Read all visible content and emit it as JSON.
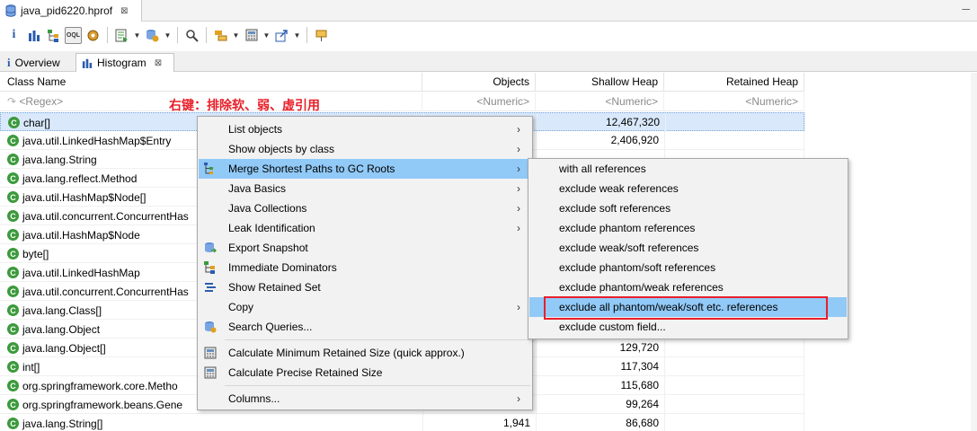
{
  "editor_tab": {
    "title": "java_pid6220.hprof",
    "close": "⊠"
  },
  "inner_tabs": {
    "overview": "Overview",
    "histogram": "Histogram",
    "close": "⊠"
  },
  "columns": {
    "class_name": "Class Name",
    "objects": "Objects",
    "shallow_heap": "Shallow Heap",
    "retained_heap": "Retained Heap"
  },
  "filters": {
    "class_name": "<Regex>",
    "objects": "<Numeric>",
    "shallow_heap": "<Numeric>",
    "retained_heap": "<Numeric>"
  },
  "annotation": "右键：排除软、弱、虚引用",
  "rows": [
    {
      "name": "char[]",
      "objects": "",
      "shallow": "12,467,320"
    },
    {
      "name": "java.util.LinkedHashMap$Entry",
      "objects": "",
      "shallow": "2,406,920"
    },
    {
      "name": "java.lang.String",
      "objects": "",
      "shallow": ""
    },
    {
      "name": "java.lang.reflect.Method",
      "objects": "",
      "shallow": ""
    },
    {
      "name": "java.util.HashMap$Node[]",
      "objects": "",
      "shallow": ""
    },
    {
      "name": "java.util.concurrent.ConcurrentHas",
      "objects": "",
      "shallow": ""
    },
    {
      "name": "java.util.HashMap$Node",
      "objects": "",
      "shallow": ""
    },
    {
      "name": "byte[]",
      "objects": "",
      "shallow": ""
    },
    {
      "name": "java.util.LinkedHashMap",
      "objects": "",
      "shallow": ""
    },
    {
      "name": "java.util.concurrent.ConcurrentHas",
      "objects": "",
      "shallow": ""
    },
    {
      "name": "java.lang.Class[]",
      "objects": "",
      "shallow": ""
    },
    {
      "name": "java.lang.Object",
      "objects": "",
      "shallow": ""
    },
    {
      "name": "java.lang.Object[]",
      "objects": "",
      "shallow": "129,720"
    },
    {
      "name": "int[]",
      "objects": "",
      "shallow": "117,304"
    },
    {
      "name": "org.springframework.core.Metho",
      "objects": "",
      "shallow": "115,680"
    },
    {
      "name": "org.springframework.beans.Gene",
      "objects": "",
      "shallow": "99,264"
    },
    {
      "name": "java.lang.String[]",
      "objects": "1,941",
      "shallow": "86,680"
    }
  ],
  "context_menu": {
    "list_objects": "List objects",
    "show_objects_by_class": "Show objects by class",
    "merge_shortest_paths": "Merge Shortest Paths to GC Roots",
    "java_basics": "Java Basics",
    "java_collections": "Java Collections",
    "leak_identification": "Leak Identification",
    "export_snapshot": "Export Snapshot",
    "immediate_dominators": "Immediate Dominators",
    "show_retained_set": "Show Retained Set",
    "copy": "Copy",
    "search_queries": "Search Queries...",
    "calc_min_retained": "Calculate Minimum Retained Size (quick approx.)",
    "calc_precise_retained": "Calculate Precise Retained Size",
    "columns": "Columns..."
  },
  "submenu": {
    "with_all": "with all references",
    "exclude_weak": "exclude weak references",
    "exclude_soft": "exclude soft references",
    "exclude_phantom": "exclude phantom references",
    "exclude_weak_soft": "exclude weak/soft references",
    "exclude_phantom_soft": "exclude phantom/soft references",
    "exclude_phantom_weak": "exclude phantom/weak references",
    "exclude_all": "exclude all phantom/weak/soft etc. references",
    "exclude_custom": "exclude custom field..."
  },
  "colors": {
    "highlight": "#91c9f7",
    "annotation_red": "#e8202a",
    "selection": "#d9e8fb",
    "class_icon": "#3c9a3c"
  }
}
